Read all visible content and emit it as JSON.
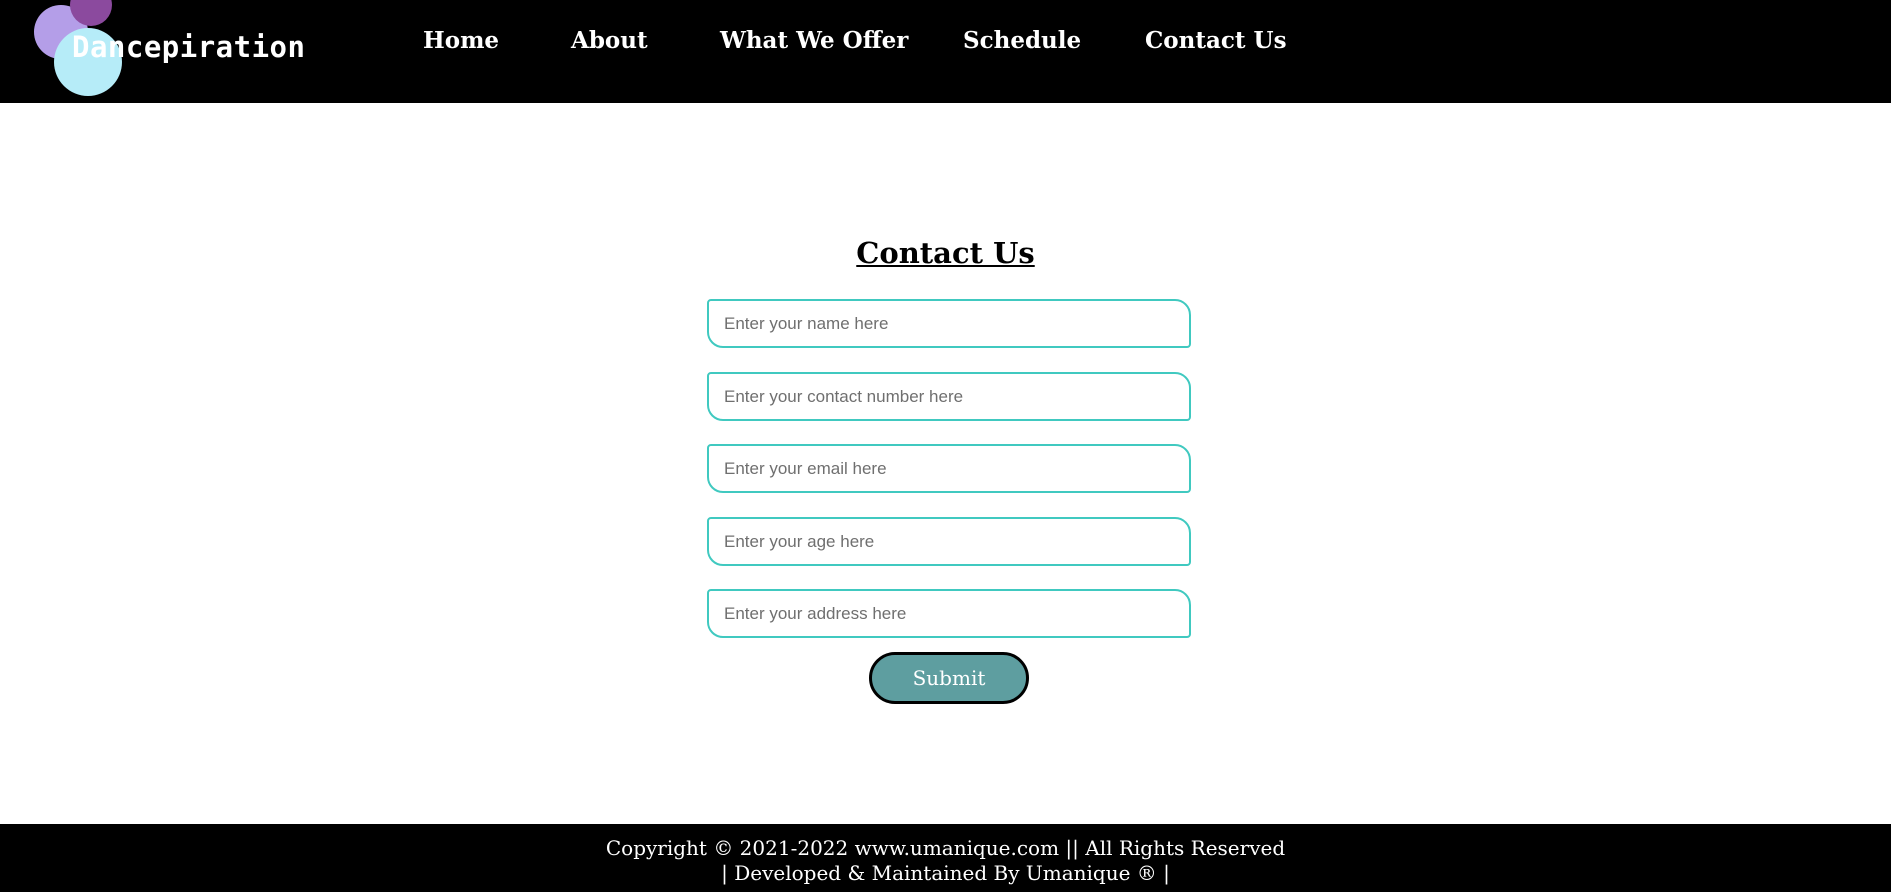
{
  "brand": {
    "name": "Dancepiration",
    "colors": {
      "lavender": "#b49ee8",
      "purple": "#8b4a9e",
      "cyan": "#b6ecf8"
    }
  },
  "nav": {
    "items": [
      {
        "label": "Home"
      },
      {
        "label": "About"
      },
      {
        "label": "What We Offer"
      },
      {
        "label": "Schedule"
      },
      {
        "label": "Contact Us"
      }
    ]
  },
  "contact": {
    "title": "Contact Us",
    "fields": [
      {
        "placeholder": "Enter your name here",
        "value": ""
      },
      {
        "placeholder": "Enter your contact number here",
        "value": ""
      },
      {
        "placeholder": "Enter your email here",
        "value": ""
      },
      {
        "placeholder": "Enter your age here",
        "value": ""
      },
      {
        "placeholder": "Enter your address here",
        "value": ""
      }
    ],
    "submit_label": "Submit",
    "colors": {
      "field_border": "#40c9c0",
      "submit_bg": "#5e9ea0"
    }
  },
  "footer": {
    "line1": "Copyright © 2021-2022 www.umanique.com || All Rights Reserved",
    "line2": "| Developed & Maintained By Umanique ® |"
  }
}
